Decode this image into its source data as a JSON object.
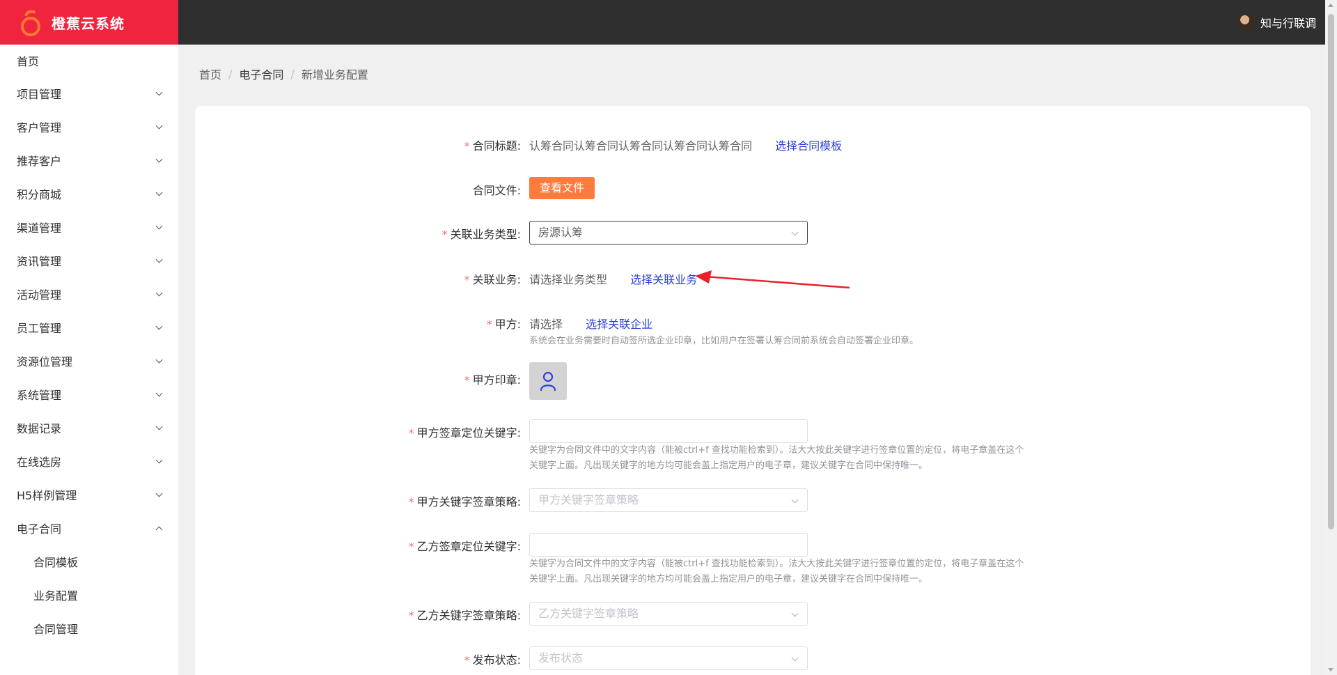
{
  "app": {
    "name": "橙蕉云系统"
  },
  "user": {
    "name": "知与行联调"
  },
  "sidebar": {
    "home": "首页",
    "items": [
      {
        "label": "项目管理"
      },
      {
        "label": "客户管理"
      },
      {
        "label": "推荐客户"
      },
      {
        "label": "积分商城"
      },
      {
        "label": "渠道管理"
      },
      {
        "label": "资讯管理"
      },
      {
        "label": "活动管理"
      },
      {
        "label": "员工管理"
      },
      {
        "label": "资源位管理"
      },
      {
        "label": "系统管理"
      },
      {
        "label": "数据记录"
      },
      {
        "label": "在线选房"
      },
      {
        "label": "H5样例管理"
      }
    ],
    "open_group": {
      "label": "电子合同",
      "children": [
        "合同模板",
        "业务配置",
        "合同管理"
      ]
    }
  },
  "breadcrumb": [
    "首页",
    "电子合同",
    "新增业务配置"
  ],
  "form": {
    "title": {
      "label": "合同标题:",
      "value": "认筹合同认筹合同认筹合同认筹合同认筹合同",
      "link": "选择合同模板"
    },
    "file": {
      "label": "合同文件:",
      "button": "查看文件"
    },
    "biz_type": {
      "label": "关联业务类型:",
      "value": "房源认筹"
    },
    "biz": {
      "label": "关联业务:",
      "value": "请选择业务类型",
      "link": "选择关联业务"
    },
    "party_a": {
      "label": "甲方:",
      "value": "请选择",
      "link": "选择关联企业",
      "hint": "系统会在业务需要时自动签所选企业印章，比如用户在签署认筹合同前系统会自动签署企业印章。"
    },
    "party_a_seal": {
      "label": "甲方印章:"
    },
    "party_a_keyword": {
      "label": "甲方签章定位关键字:",
      "hint1": "关键字为合同文件中的文字内容（能被ctrl+f 查找功能检索到）。法大大按此关键字进行签章位置的定位，将电子章盖在这个",
      "hint2": "关键字上面。凡出现关键字的地方均可能会盖上指定用户的电子章，建议关键字在合同中保持唯一。"
    },
    "party_a_strategy": {
      "label": "甲方关键字签章策略:",
      "placeholder": "甲方关键字签章策略"
    },
    "party_b_keyword": {
      "label": "乙方签章定位关键字:",
      "hint1": "关键字为合同文件中的文字内容（能被ctrl+f 查找功能检索到）。法大大按此关键字进行签章位置的定位，将电子章盖在这个",
      "hint2": "关键字上面。凡出现关键字的地方均可能会盖上指定用户的电子章，建议关键字在合同中保持唯一。"
    },
    "party_b_strategy": {
      "label": "乙方关键字签章策略:",
      "placeholder": "乙方关键字签章策略"
    },
    "publish": {
      "label": "发布状态:",
      "placeholder": "发布状态"
    }
  },
  "colors": {
    "brand": "#f0243f",
    "accent": "#ff7a3d",
    "link": "#2e40d8",
    "required": "#f56c6c",
    "annotation_arrow": "#e8202a"
  },
  "icons": {
    "seal_placeholder": "user-icon",
    "dropdown": "chevron-down-icon"
  }
}
